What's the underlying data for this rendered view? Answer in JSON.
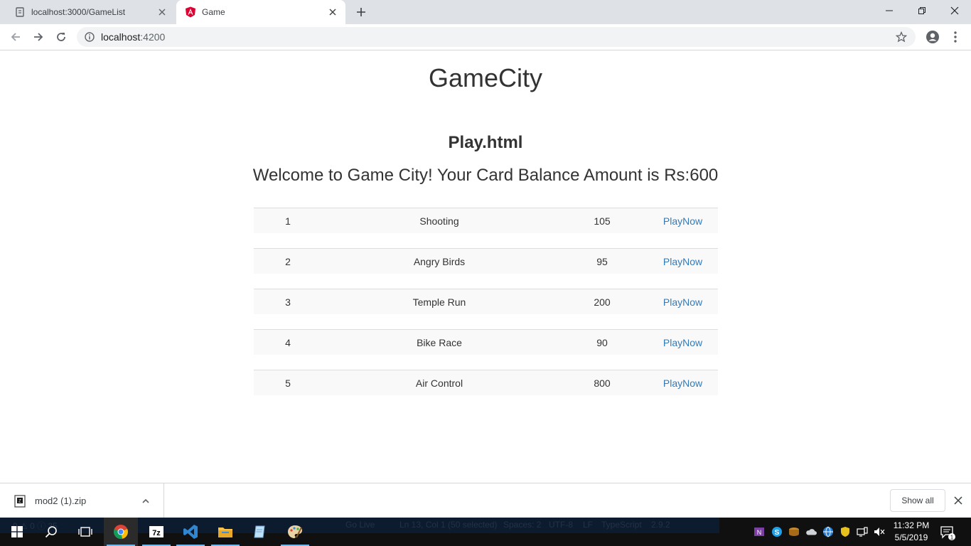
{
  "browser": {
    "tabs": [
      {
        "title": "localhost:3000/GameList"
      },
      {
        "title": "Game"
      }
    ],
    "url_host": "localhost",
    "url_port": ":4200"
  },
  "page": {
    "app_title": "GameCity",
    "sub_title": "Play.html",
    "welcome": "Welcome to Game City! Your Card Balance Amount is Rs:600",
    "games": [
      {
        "id": "1",
        "name": "Shooting",
        "price": "105",
        "action": "PlayNow"
      },
      {
        "id": "2",
        "name": "Angry Birds",
        "price": "95",
        "action": "PlayNow"
      },
      {
        "id": "3",
        "name": "Temple Run",
        "price": "200",
        "action": "PlayNow"
      },
      {
        "id": "4",
        "name": "Bike Race",
        "price": "90",
        "action": "PlayNow"
      },
      {
        "id": "5",
        "name": "Air Control",
        "price": "800",
        "action": "PlayNow"
      }
    ]
  },
  "downloads": {
    "file_name": "mod2 (1).zip",
    "show_all": "Show all"
  },
  "taskbar": {
    "status_ghost": {
      "problems": "0 ⚠ 0 ⓘ 35",
      "go_live": "Go Live",
      "cursor": "Ln 13, Col 1 (50 selected)",
      "spaces": "Spaces: 2",
      "encoding": "UTF-8",
      "eol": "LF",
      "language": "TypeScript",
      "version": "2.9.2"
    },
    "time": "11:32 PM",
    "date": "5/5/2019",
    "notification_count": "1"
  },
  "colors": {
    "link": "#337ab7",
    "row_bg": "#f9f9f9",
    "taskbar": "#101010",
    "tab_strip": "#dee1e6"
  }
}
